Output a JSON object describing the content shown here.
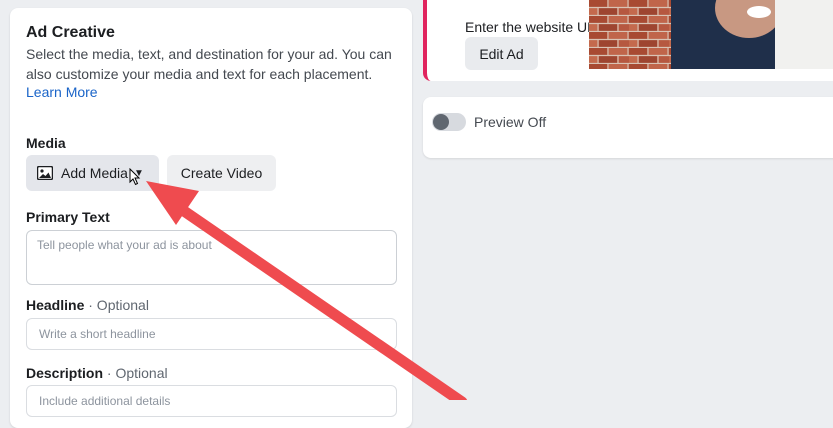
{
  "ad_creative": {
    "title": "Ad Creative",
    "description": "Select the media, text, and destination for your ad. You can also customize your media and text for each placement.",
    "learn_more": "Learn More",
    "media": {
      "label": "Media",
      "add_media_button": "Add Media",
      "create_video_button": "Create Video"
    },
    "primary_text": {
      "label": "Primary Text",
      "placeholder": "Tell people what your ad is about"
    },
    "headline": {
      "label": "Headline",
      "optional": "· Optional",
      "placeholder": "Write a short headline"
    },
    "description_field": {
      "label": "Description",
      "optional": "· Optional",
      "placeholder": "Include additional details"
    }
  },
  "website": {
    "text": "Enter the website URL",
    "edit_ad_button": "Edit Ad"
  },
  "preview": {
    "label": "Preview Off",
    "toggle_on": false
  },
  "colors": {
    "accent_bar": "#e0245e",
    "link": "#1a64c8",
    "annotation_arrow": "#ef4b4f"
  },
  "icons": {
    "media": "image-icon",
    "dropdown": "caret-down-icon",
    "annotation": "red-arrow-annotation"
  }
}
